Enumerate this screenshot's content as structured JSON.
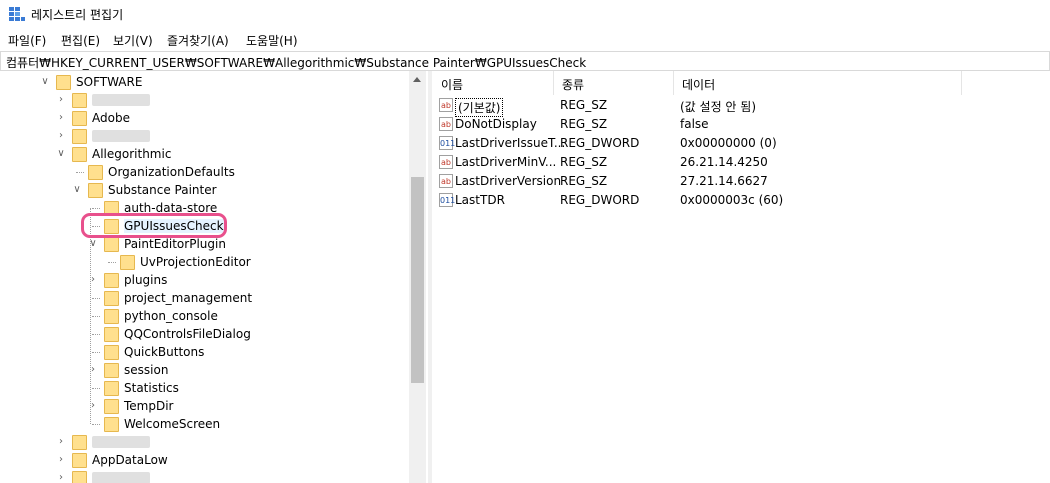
{
  "window": {
    "title": "레지스트리 편집기"
  },
  "menu": [
    "파일(F)",
    "편집(E)",
    "보기(V)",
    "즐겨찾기(A)",
    "도움말(H)"
  ],
  "address": "컴퓨터₩HKEY_CURRENT_USER₩SOFTWARE₩Allegorithmic₩Substance Painter₩GPUIssuesCheck",
  "tree": [
    {
      "label": "SOFTWARE",
      "depth": 0,
      "expander": "open"
    },
    {
      "label": "",
      "depth": 1,
      "expander": "closed",
      "blurred": true
    },
    {
      "label": "Adobe",
      "depth": 1,
      "expander": "closed"
    },
    {
      "label": "",
      "depth": 1,
      "expander": "closed",
      "blurred": true
    },
    {
      "label": "Allegorithmic",
      "depth": 1,
      "expander": "open"
    },
    {
      "label": "OrganizationDefaults",
      "depth": 2,
      "expander": "none"
    },
    {
      "label": "Substance Painter",
      "depth": 2,
      "expander": "open"
    },
    {
      "label": "auth-data-store",
      "depth": 3,
      "expander": "none"
    },
    {
      "label": "GPUIssuesCheck",
      "depth": 3,
      "expander": "none",
      "selected": true
    },
    {
      "label": "PaintEditorPlugin",
      "depth": 3,
      "expander": "open"
    },
    {
      "label": "UvProjectionEditor",
      "depth": 4,
      "expander": "none"
    },
    {
      "label": "plugins",
      "depth": 3,
      "expander": "closed"
    },
    {
      "label": "project_management",
      "depth": 3,
      "expander": "none"
    },
    {
      "label": "python_console",
      "depth": 3,
      "expander": "none"
    },
    {
      "label": "QQControlsFileDialog",
      "depth": 3,
      "expander": "none"
    },
    {
      "label": "QuickButtons",
      "depth": 3,
      "expander": "none"
    },
    {
      "label": "session",
      "depth": 3,
      "expander": "closed"
    },
    {
      "label": "Statistics",
      "depth": 3,
      "expander": "none"
    },
    {
      "label": "TempDir",
      "depth": 3,
      "expander": "closed"
    },
    {
      "label": "WelcomeScreen",
      "depth": 3,
      "expander": "none"
    },
    {
      "label": "",
      "depth": 1,
      "expander": "closed",
      "blurred": true
    },
    {
      "label": "AppDataLow",
      "depth": 1,
      "expander": "closed"
    },
    {
      "label": "",
      "depth": 1,
      "expander": "closed",
      "blurred": true
    }
  ],
  "columns": [
    "이름",
    "종류",
    "데이터"
  ],
  "values": [
    {
      "name": "(기본값)",
      "type": "REG_SZ",
      "data": "(값 설정 안 됨)",
      "icon": "string-value-icon",
      "glyph": "ab"
    },
    {
      "name": "DoNotDisplay",
      "type": "REG_SZ",
      "data": "false",
      "icon": "string-value-icon",
      "glyph": "ab"
    },
    {
      "name": "LastDriverIssueT...",
      "type": "REG_DWORD",
      "data": "0x00000000 (0)",
      "icon": "binary-value-icon",
      "glyph": "011"
    },
    {
      "name": "LastDriverMinV...",
      "type": "REG_SZ",
      "data": "26.21.14.4250",
      "icon": "string-value-icon",
      "glyph": "ab"
    },
    {
      "name": "LastDriverVersion",
      "type": "REG_SZ",
      "data": "27.21.14.6627",
      "icon": "string-value-icon",
      "glyph": "ab"
    },
    {
      "name": "LastTDR",
      "type": "REG_DWORD",
      "data": "0x0000003c (60)",
      "icon": "binary-value-icon",
      "glyph": "011"
    }
  ]
}
